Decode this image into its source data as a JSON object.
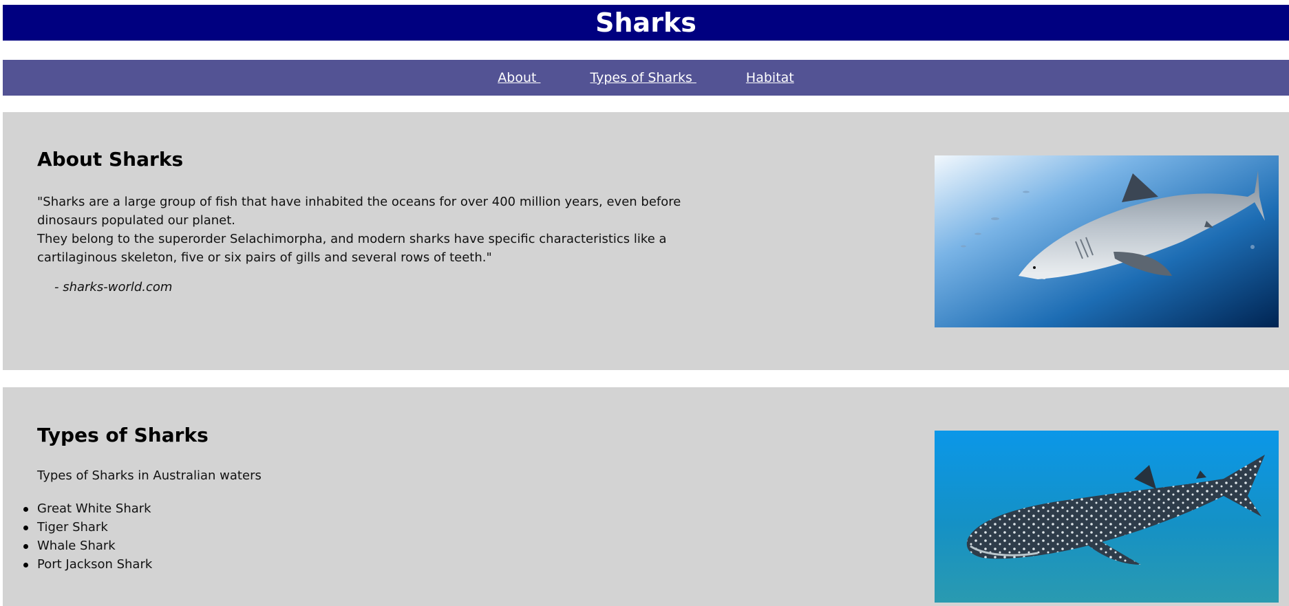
{
  "header": {
    "title": "Sharks"
  },
  "nav": {
    "items": [
      {
        "label": "About "
      },
      {
        "label": "Types of Sharks "
      },
      {
        "label": "Habitat"
      }
    ]
  },
  "about": {
    "heading": "About Sharks",
    "quote_line1": "\"Sharks are a large group of fish that have inhabited the oceans for over 400 million years, even before dinosaurs populated our planet.",
    "quote_line2": "They belong to the superorder Selachimorpha, and modern sharks have specific characteristics like a cartilaginous skeleton, five or six pairs of gills and several rows of teeth.\"",
    "citation": "- sharks-world.com",
    "image_icon": "great-white-shark-photo"
  },
  "types": {
    "heading": "Types of Sharks",
    "intro": "Types of Sharks in Australian waters",
    "list": [
      "Great White Shark",
      "Tiger Shark",
      "Whale Shark",
      "Port Jackson Shark"
    ],
    "image_icon": "whale-shark-photo"
  },
  "colors": {
    "header_bg": "#000080",
    "nav_bg": "#535394",
    "section_bg": "#d3d3d3"
  }
}
